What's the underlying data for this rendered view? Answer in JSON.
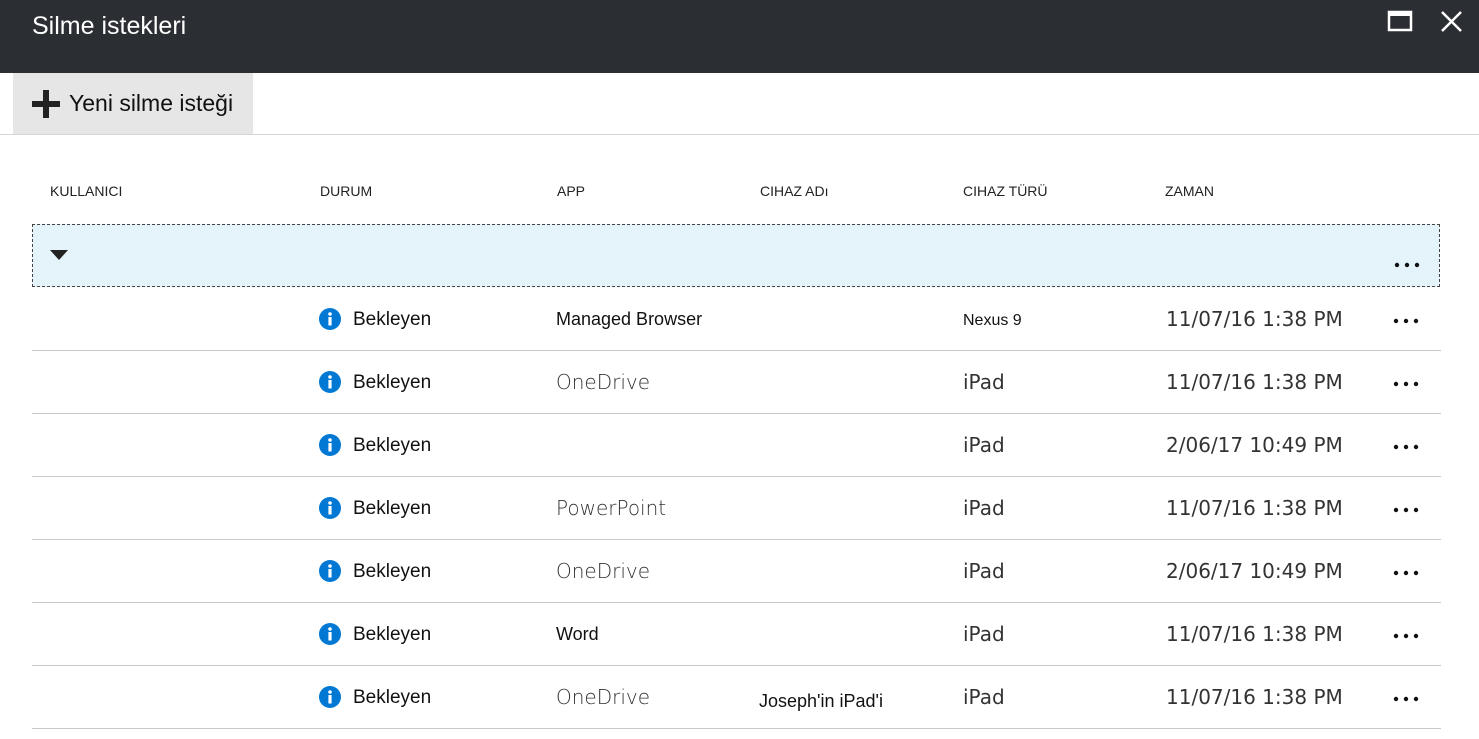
{
  "window": {
    "title": "Silme istekleri",
    "maximize_icon": "maximize-icon",
    "close_icon": "close-icon"
  },
  "toolbar": {
    "new_request_label": "Yeni silme isteği",
    "new_request_icon": "plus-icon"
  },
  "table": {
    "headers": [
      "KULLANICI",
      "DURUM",
      "APP",
      "CIHAZ ADı",
      "CIHAZ TÜRÜ",
      "ZAMAN"
    ],
    "group_row": {
      "expand_icon": "caret-down-icon",
      "more_icon": "ellipsis-icon"
    },
    "rows": [
      {
        "user": "",
        "status": "Bekleyen",
        "app": "Managed Browser",
        "device_name": "",
        "device_type": "Nexus 9",
        "time": "11/07/16 1:38 PM"
      },
      {
        "user": "",
        "status": "Bekleyen",
        "app": "OneDrive",
        "device_name": "",
        "device_type": "iPad",
        "time": "11/07/16 1:38 PM"
      },
      {
        "user": "",
        "status": "Bekleyen",
        "app": "",
        "device_name": "",
        "device_type": "iPad",
        "time": "2/06/17 10:49 PM"
      },
      {
        "user": "",
        "status": "Bekleyen",
        "app": "PowerPoint",
        "device_name": "",
        "device_type": "iPad",
        "time": "11/07/16 1:38 PM"
      },
      {
        "user": "",
        "status": "Bekleyen",
        "app": "OneDrive",
        "device_name": "",
        "device_type": "iPad",
        "time": "2/06/17 10:49 PM"
      },
      {
        "user": "",
        "status": "Bekleyen",
        "app": "Word",
        "device_name": "",
        "device_type": "iPad",
        "time": "11/07/16 1:38 PM"
      },
      {
        "user": "",
        "status": "Bekleyen",
        "app": "OneDrive",
        "device_name": "Joseph'in iPad'i",
        "device_type": "iPad",
        "time": "11/07/16 1:38 PM"
      }
    ],
    "status_icon": "info-icon",
    "row_more_icon": "ellipsis-icon"
  },
  "colors": {
    "titlebar": "#2b2f33",
    "toolbar_button": "#e6e6e6",
    "group_row_bg": "#e5f4fb",
    "info_icon": "#0078d4"
  }
}
